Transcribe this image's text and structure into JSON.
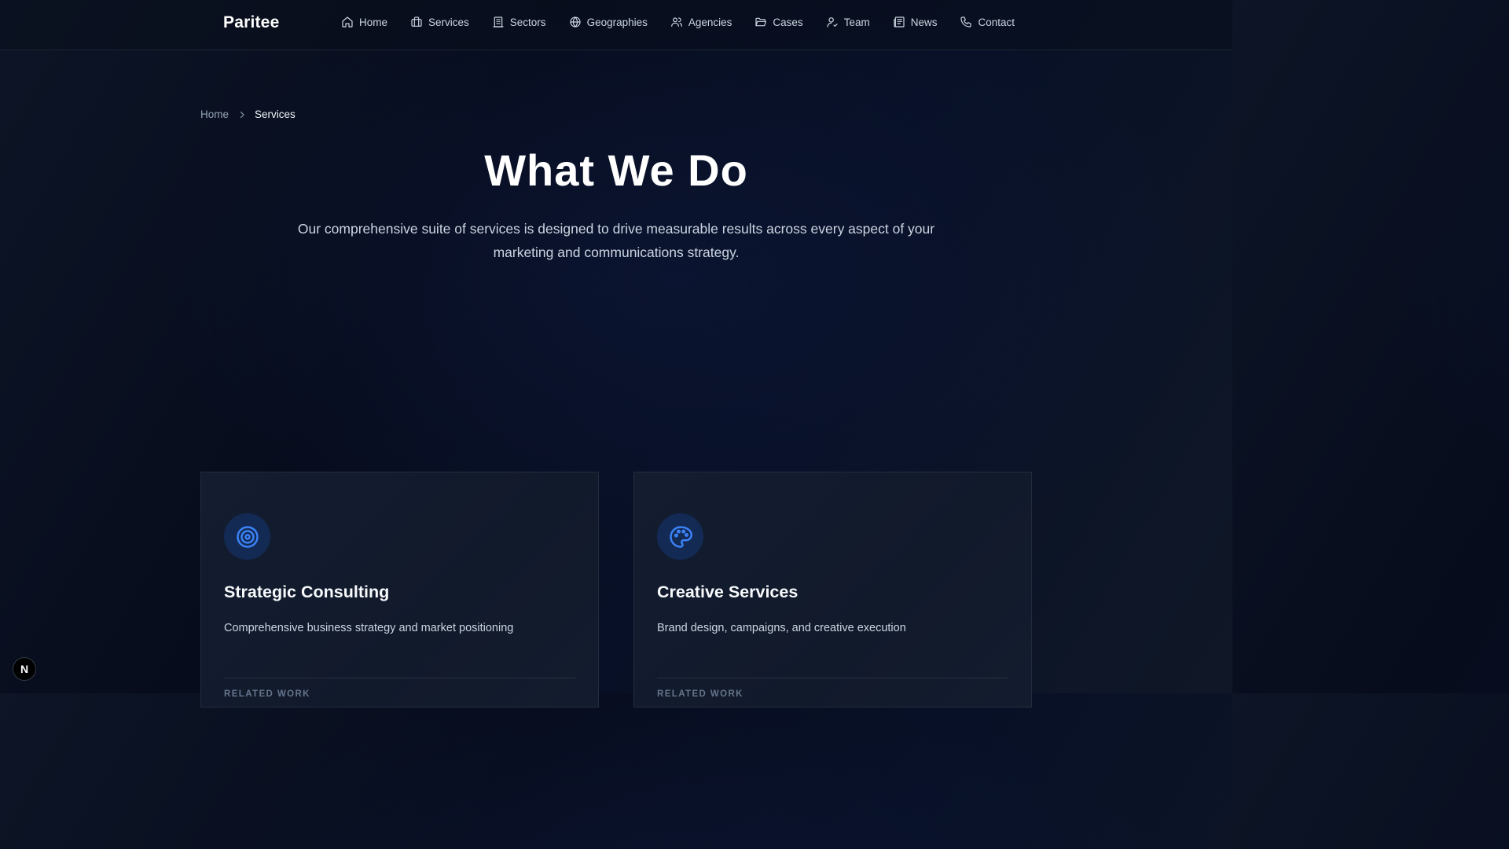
{
  "brand": {
    "name": "Paritee"
  },
  "nav": {
    "items": [
      {
        "label": "Home",
        "icon": "home-icon"
      },
      {
        "label": "Services",
        "icon": "briefcase-icon"
      },
      {
        "label": "Sectors",
        "icon": "building-icon"
      },
      {
        "label": "Geographies",
        "icon": "globe-icon"
      },
      {
        "label": "Agencies",
        "icon": "users-icon"
      },
      {
        "label": "Cases",
        "icon": "folder-open-icon"
      },
      {
        "label": "Team",
        "icon": "user-check-icon"
      },
      {
        "label": "News",
        "icon": "newspaper-icon"
      },
      {
        "label": "Contact",
        "icon": "phone-icon"
      }
    ]
  },
  "breadcrumb": {
    "home": "Home",
    "current": "Services",
    "separator_icon": "chevron-right-icon"
  },
  "hero": {
    "title": "What We Do",
    "subtitle": "Our comprehensive suite of services is designed to drive measurable results across every aspect of your marketing and communications strategy."
  },
  "cards": [
    {
      "icon": "target-icon",
      "title": "Strategic Consulting",
      "description": "Comprehensive business strategy and market positioning",
      "related_label": "RELATED WORK"
    },
    {
      "icon": "palette-icon",
      "title": "Creative Services",
      "description": "Brand design, campaigns, and creative execution",
      "related_label": "RELATED WORK"
    }
  ],
  "devtools": {
    "label": "N"
  },
  "colors": {
    "accent": "#3b82f6",
    "icon_bg": "#132a55",
    "text_primary": "#ffffff",
    "text_secondary": "#cbd5e1",
    "text_muted": "#94a3b8"
  }
}
